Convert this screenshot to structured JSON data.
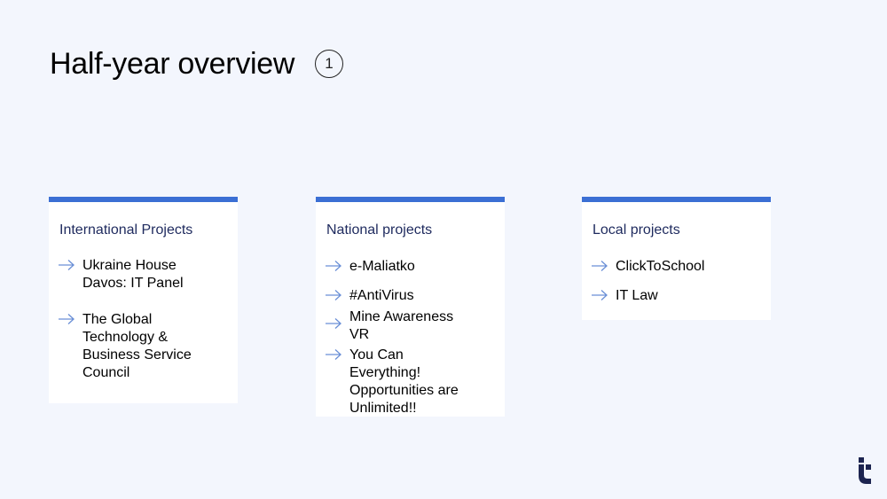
{
  "slide": {
    "title": "Half-year overview",
    "page_number": "1"
  },
  "colors": {
    "background": "#f3f6fd",
    "card_accent": "#3b6fd4",
    "arrow": "#6a8fd6",
    "card_title": "#1e2a5e",
    "logo": "#1c2450"
  },
  "icons": {
    "bullet": "arrow-right-icon",
    "logo": "brand-logo-icon"
  },
  "cards": [
    {
      "title": "International Projects",
      "items": [
        "Ukraine House Davos: IT Panel",
        "The Global Technology & Business Service Council"
      ]
    },
    {
      "title": "National projects",
      "items": [
        "e-Maliatko",
        "#AntiVirus",
        "Mine Awareness VR",
        "You Can Everything! Opportunities are Unlimited!!"
      ]
    },
    {
      "title": "Local projects",
      "items": [
        "ClickToSchool",
        "IT Law"
      ]
    }
  ]
}
